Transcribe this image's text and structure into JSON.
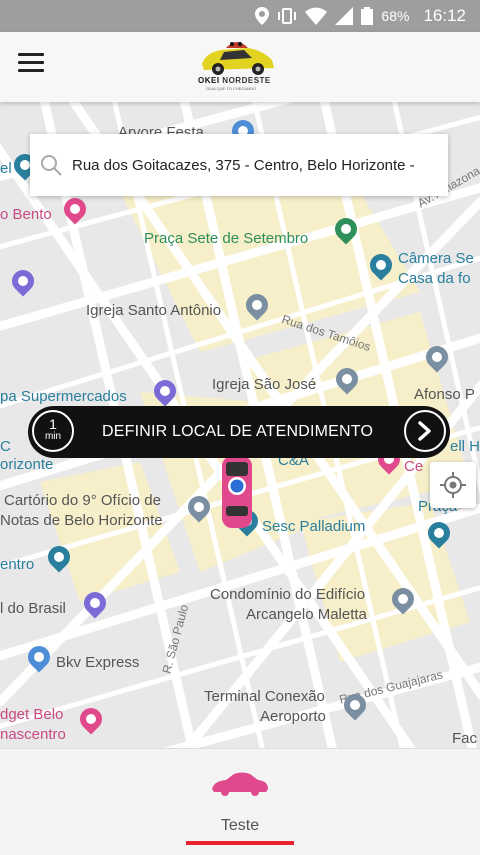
{
  "statusbar": {
    "battery": "68%",
    "time": "16:12"
  },
  "app": {
    "brand": "OKEI",
    "brand_suffix": "NORDESTE",
    "tagline": "GUIA QUE TO CHEGANDO"
  },
  "search": {
    "address": "Rua dos Goitacazes, 375 - Centro, Belo Horizonte -"
  },
  "pickup": {
    "eta_value": "1",
    "eta_unit": "min",
    "label": "DEFINIR LOCAL DE ATENDIMENTO"
  },
  "map_labels": {
    "praca": "Praça Sete de Setembro",
    "camera1": "Câmera Se",
    "camera2": "Casa da fo",
    "igreja_antonio": "Igreja Santo Antônio",
    "rua_tamoios": "Rua dos Tamôios",
    "igreja_jose": "Igreja São José",
    "afonso": "Afonso P",
    "av_amazonas": "Av. Amazona",
    "bento": "o Bento",
    "el": "el",
    "supermercados": "pa Supermercados",
    "c_left": "C",
    "horizonte": "orizonte",
    "cea": "C&A",
    "ce": "Ce",
    "ell_ho": "ell Ho",
    "praca_right": "Praça",
    "cartorio1": "Cartório do 9° Ofício de",
    "cartorio2": "Notas de Belo Horizonte",
    "sesc": "Sesc Palladium",
    "centro": "entro",
    "condominio1": "Condomínio do Edifício",
    "condominio2": "Arcangelo Maletta",
    "do_brasil": "l do Brasil",
    "r_sao_paulo": "R. São Paulo",
    "bkv": "Bkv Express",
    "rua_guajajaras": "Rua dos Guajajaras",
    "dget1": "dget Belo",
    "dget2": "nascentro",
    "terminal1": "Terminal Conexão",
    "terminal2": "Aeroporto",
    "fac": "Fac",
    "arvore": "Arvore Festa"
  },
  "tabs": [
    {
      "label": "Teste",
      "selected": true
    }
  ],
  "colors": {
    "accent": "#e8232e",
    "car": "#e04a8c",
    "park": "#2f8f5a",
    "dark_bar": "#111111"
  }
}
